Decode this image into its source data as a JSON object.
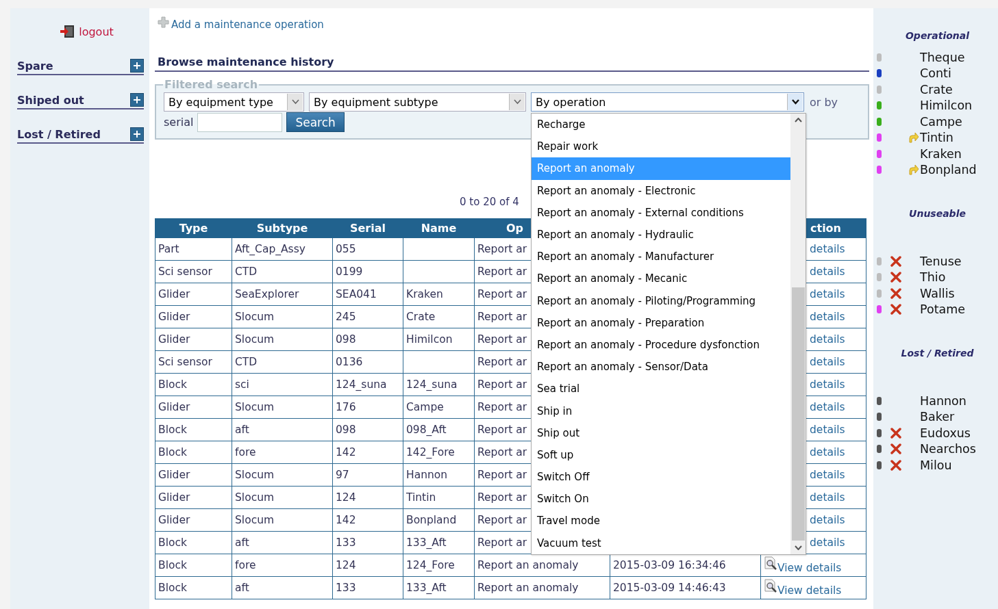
{
  "sidebar": {
    "logout": "logout",
    "sections": [
      {
        "label": "Spare"
      },
      {
        "label": "Shiped out"
      },
      {
        "label": "Lost / Retired"
      }
    ]
  },
  "main": {
    "add_link": "Add a maintenance operation",
    "title": "Browse maintenance history",
    "filter": {
      "legend": "Filtered search",
      "selects": [
        {
          "value": "By equipment type",
          "open": false
        },
        {
          "value": "By equipment subtype",
          "open": false
        },
        {
          "value": "By operation",
          "open": true,
          "options": [
            {
              "label": "Recharge",
              "selected": false
            },
            {
              "label": "Repair work",
              "selected": false
            },
            {
              "label": "Report an anomaly",
              "selected": true
            },
            {
              "label": "Report an anomaly - Electronic",
              "selected": false
            },
            {
              "label": "Report an anomaly - External conditions",
              "selected": false
            },
            {
              "label": "Report an anomaly - Hydraulic",
              "selected": false
            },
            {
              "label": "Report an anomaly - Manufacturer",
              "selected": false
            },
            {
              "label": "Report an anomaly - Mecanic",
              "selected": false
            },
            {
              "label": "Report an anomaly - Piloting/Programming",
              "selected": false
            },
            {
              "label": "Report an anomaly - Preparation",
              "selected": false
            },
            {
              "label": "Report an anomaly - Procedure dysfonction",
              "selected": false
            },
            {
              "label": "Report an anomaly - Sensor/Data",
              "selected": false
            },
            {
              "label": "Sea trial",
              "selected": false
            },
            {
              "label": "Ship in",
              "selected": false
            },
            {
              "label": "Ship out",
              "selected": false
            },
            {
              "label": "Soft up",
              "selected": false
            },
            {
              "label": "Switch Off",
              "selected": false
            },
            {
              "label": "Switch On",
              "selected": false
            },
            {
              "label": "Travel mode",
              "selected": false
            },
            {
              "label": "Vacuum test",
              "selected": false
            }
          ]
        }
      ],
      "or_by": "or by",
      "serial_label": "serial",
      "search_button": "Search"
    },
    "pager": "0 to 20 of 4",
    "table": {
      "columns": {
        "type": "Type",
        "subtype": "Subtype",
        "serial": "Serial",
        "name": "Name",
        "operation": "Op",
        "action": "ction"
      },
      "rows": [
        {
          "type": "Part",
          "subtype": "Aft_Cap_Assy",
          "serial": "055",
          "operation": "Report ar",
          "action": "details",
          "view_icon": false
        },
        {
          "type": "Sci sensor",
          "subtype": "CTD",
          "serial": "0199",
          "operation": "Report ar",
          "action": "details",
          "view_icon": false
        },
        {
          "type": "Glider",
          "subtype": "SeaExplorer",
          "serial": "SEA041",
          "name": "Kraken",
          "operation": "Report ar",
          "action": "details",
          "view_icon": false
        },
        {
          "type": "Glider",
          "subtype": "Slocum",
          "serial": "245",
          "name": "Crate",
          "operation": "Report ar",
          "action": "details",
          "view_icon": false
        },
        {
          "type": "Glider",
          "subtype": "Slocum",
          "serial": "098",
          "name": "Himilcon",
          "operation": "Report ar",
          "action": "details",
          "view_icon": false
        },
        {
          "type": "Sci sensor",
          "subtype": "CTD",
          "serial": "0136",
          "operation": "Report ar",
          "action": "details",
          "view_icon": false
        },
        {
          "type": "Block",
          "subtype": "sci",
          "serial": "124_suna",
          "name": "124_suna",
          "operation": "Report ar",
          "action": "details",
          "view_icon": false
        },
        {
          "type": "Glider",
          "subtype": "Slocum",
          "serial": "176",
          "name": "Campe",
          "operation": "Report ar",
          "action": "details",
          "view_icon": false
        },
        {
          "type": "Block",
          "subtype": "aft",
          "serial": "098",
          "name": "098_Aft",
          "operation": "Report ar",
          "action": "details",
          "view_icon": false
        },
        {
          "type": "Block",
          "subtype": "fore",
          "serial": "142",
          "name": "142_Fore",
          "operation": "Report ar",
          "action": "details",
          "view_icon": false
        },
        {
          "type": "Glider",
          "subtype": "Slocum",
          "serial": "97",
          "name": "Hannon",
          "operation": "Report ar",
          "action": "details",
          "view_icon": false
        },
        {
          "type": "Glider",
          "subtype": "Slocum",
          "serial": "124",
          "name": "Tintin",
          "operation": "Report ar",
          "action": "details",
          "view_icon": false
        },
        {
          "type": "Glider",
          "subtype": "Slocum",
          "serial": "142",
          "name": "Bonpland",
          "operation": "Report ar",
          "action": "details",
          "view_icon": false
        },
        {
          "type": "Block",
          "subtype": "aft",
          "serial": "133",
          "name": "133_Aft",
          "operation": "Report ar",
          "action": "details",
          "view_icon": false
        },
        {
          "type": "Block",
          "subtype": "fore",
          "serial": "124",
          "name": "124_Fore",
          "operation": "Report an anomaly",
          "date": "2015-03-09 16:34:46",
          "action": "View details",
          "view_icon": true
        },
        {
          "type": "Block",
          "subtype": "aft",
          "serial": "133",
          "name": "133_Aft",
          "operation": "Report an anomaly",
          "date": "2015-03-09 14:46:43",
          "action": "View details",
          "view_icon": true
        }
      ]
    }
  },
  "status_panel": {
    "groups": [
      {
        "title": "Operational",
        "items": [
          {
            "name": "Theque",
            "color": "#bdbdbd",
            "kind": "plain"
          },
          {
            "name": "Conti",
            "color": "#1a3fc0",
            "kind": "plain"
          },
          {
            "name": "Crate",
            "color": "#bdbdbd",
            "kind": "plain"
          },
          {
            "name": "Himilcon",
            "color": "#3aae1c",
            "kind": "plain"
          },
          {
            "name": "Campe",
            "color": "#3aae1c",
            "kind": "plain"
          },
          {
            "name": "Tintin",
            "color": "#e040f0",
            "kind": "arrow"
          },
          {
            "name": "Kraken",
            "color": "#e040f0",
            "kind": "plain"
          },
          {
            "name": "Bonpland",
            "color": "#e040f0",
            "kind": "arrow"
          }
        ]
      },
      {
        "title": "Unuseable",
        "items": [
          {
            "name": "Tenuse",
            "color": "#bdbdbd",
            "kind": "cross"
          },
          {
            "name": "Thio",
            "color": "#bdbdbd",
            "kind": "cross"
          },
          {
            "name": "Wallis",
            "color": "#bdbdbd",
            "kind": "cross"
          },
          {
            "name": "Potame",
            "color": "#e040f0",
            "kind": "cross"
          }
        ]
      },
      {
        "title": "Lost / Retired",
        "items": [
          {
            "name": "Hannon",
            "color": "#555555",
            "kind": "plain"
          },
          {
            "name": "Baker",
            "color": "#555555",
            "kind": "plain"
          },
          {
            "name": "Eudoxus",
            "color": "#555555",
            "kind": "cross"
          },
          {
            "name": "Nearchos",
            "color": "#555555",
            "kind": "cross"
          },
          {
            "name": "Milou",
            "color": "#555555",
            "kind": "cross"
          }
        ]
      }
    ]
  }
}
